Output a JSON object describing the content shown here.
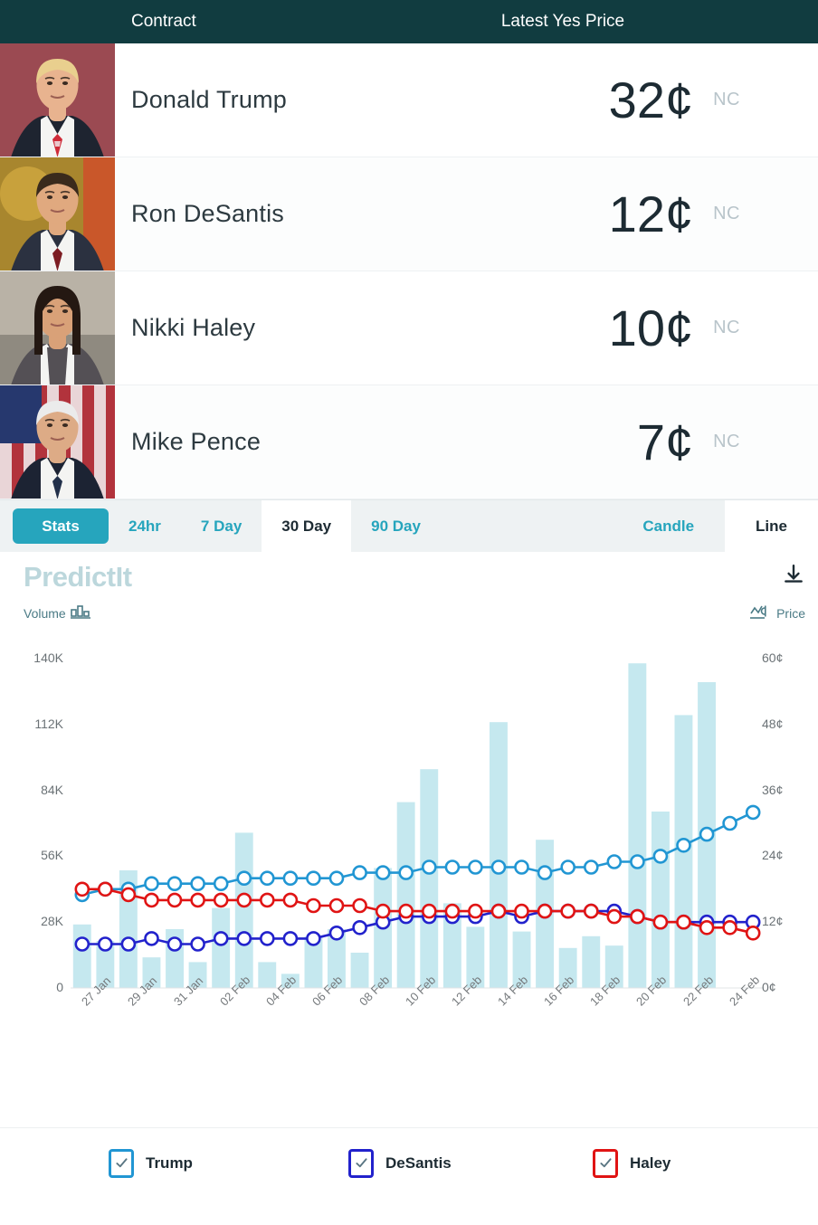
{
  "table": {
    "header": {
      "contract": "Contract",
      "price": "Latest Yes Price"
    },
    "rows": [
      {
        "name": "Donald Trump",
        "price": "32¢",
        "change": "NC",
        "photo": "donald-trump-photo"
      },
      {
        "name": "Ron DeSantis",
        "price": "12¢",
        "change": "NC",
        "photo": "ron-desantis-photo"
      },
      {
        "name": "Nikki Haley",
        "price": "10¢",
        "change": "NC",
        "photo": "nikki-haley-photo"
      },
      {
        "name": "Mike Pence",
        "price": "7¢",
        "change": "NC",
        "photo": "mike-pence-photo"
      }
    ]
  },
  "tabs": {
    "stats_label": "Stats",
    "ranges": [
      {
        "label": "24hr",
        "active": false
      },
      {
        "label": "7 Day",
        "active": false
      },
      {
        "label": "30 Day",
        "active": true
      },
      {
        "label": "90 Day",
        "active": false
      }
    ],
    "modes": [
      {
        "label": "Candle",
        "active": false
      },
      {
        "label": "Line",
        "active": true
      }
    ]
  },
  "chart_panel": {
    "watermark": "PredictIt",
    "volume_label": "Volume",
    "price_label": "Price",
    "download_icon": "download-icon",
    "volume_icon": "bar-chart-icon",
    "price_icon": "line-chart-cent-icon"
  },
  "legend": [
    {
      "label": "Trump",
      "color": "#2196d3"
    },
    {
      "label": "DeSantis",
      "color": "#2222cc"
    },
    {
      "label": "Haley",
      "color": "#e01414"
    }
  ],
  "colors": {
    "header_bg": "#113C40",
    "accent_teal": "#26a5bd",
    "bar_fill": "#c5e8ef",
    "trump": "#2196d3",
    "desantis": "#2222cc",
    "haley": "#e01414"
  },
  "chart_data": {
    "type": "line",
    "title": "",
    "xlabel": "",
    "grid": false,
    "legend_position": "bottom",
    "categories": [
      "27 Jan",
      "28 Jan",
      "29 Jan",
      "30 Jan",
      "31 Jan",
      "01 Feb",
      "02 Feb",
      "03 Feb",
      "04 Feb",
      "05 Feb",
      "06 Feb",
      "07 Feb",
      "08 Feb",
      "09 Feb",
      "10 Feb",
      "11 Feb",
      "12 Feb",
      "13 Feb",
      "14 Feb",
      "15 Feb",
      "16 Feb",
      "17 Feb",
      "18 Feb",
      "19 Feb",
      "20 Feb",
      "21 Feb",
      "22 Feb",
      "23 Feb",
      "24 Feb",
      "25 Feb"
    ],
    "xtick_labels": [
      "27 Jan",
      "29 Jan",
      "31 Jan",
      "02 Feb",
      "04 Feb",
      "06 Feb",
      "08 Feb",
      "10 Feb",
      "12 Feb",
      "14 Feb",
      "16 Feb",
      "18 Feb",
      "20 Feb",
      "22 Feb",
      "24 Feb"
    ],
    "left_axis": {
      "label": "Volume",
      "ticks": [
        "0",
        "28K",
        "56K",
        "84K",
        "112K",
        "140K"
      ],
      "ylim": [
        0,
        140000
      ]
    },
    "right_axis": {
      "label": "Price",
      "ticks": [
        "0¢",
        "12¢",
        "24¢",
        "36¢",
        "48¢",
        "60¢"
      ],
      "ylim": [
        0,
        60
      ]
    },
    "volume": {
      "name": "Volume",
      "color": "#c5e8ef",
      "values": [
        27000,
        20000,
        50000,
        13000,
        25000,
        11000,
        34000,
        66000,
        11000,
        6000,
        22000,
        25000,
        15000,
        51000,
        79000,
        93000,
        36000,
        26000,
        113000,
        24000,
        63000,
        17000,
        22000,
        18000,
        138000,
        75000,
        116000,
        130000,
        0,
        0
      ]
    },
    "series": [
      {
        "name": "Trump",
        "color": "#2196d3",
        "values": [
          17,
          18,
          18,
          19,
          19,
          19,
          19,
          20,
          20,
          20,
          20,
          20,
          21,
          21,
          21,
          22,
          22,
          22,
          22,
          22,
          21,
          22,
          22,
          23,
          23,
          24,
          26,
          28,
          30,
          32
        ]
      },
      {
        "name": "DeSantis",
        "color": "#2222cc",
        "values": [
          8,
          8,
          8,
          9,
          8,
          8,
          9,
          9,
          9,
          9,
          9,
          10,
          11,
          12,
          13,
          13,
          13,
          13,
          14,
          13,
          14,
          14,
          14,
          14,
          13,
          12,
          12,
          12,
          12,
          12
        ]
      },
      {
        "name": "Haley",
        "color": "#e01414",
        "values": [
          18,
          18,
          17,
          16,
          16,
          16,
          16,
          16,
          16,
          16,
          15,
          15,
          15,
          14,
          14,
          14,
          14,
          14,
          14,
          14,
          14,
          14,
          14,
          13,
          13,
          12,
          12,
          11,
          11,
          10
        ]
      }
    ]
  }
}
